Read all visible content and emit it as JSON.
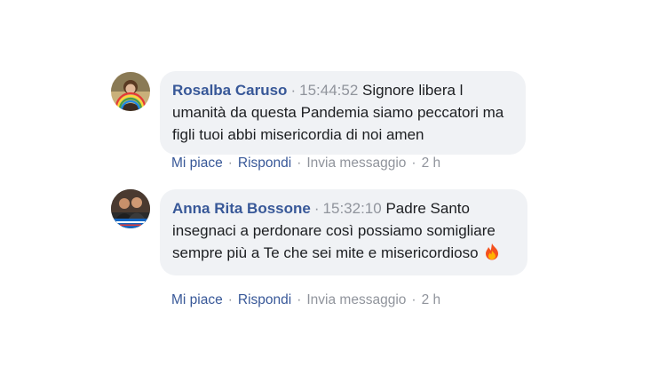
{
  "comments": [
    {
      "author": "Rosalba Caruso",
      "separator": "·",
      "timestamp": "15:44:52",
      "text": "Signore libera l umanità da questa Pandemia siamo peccatori ma figli tuoi abbi misericordia di noi amen",
      "actions": {
        "like": "Mi piace",
        "reply": "Rispondi",
        "message": "Invia messaggio",
        "age": "2 h",
        "dot": "·"
      }
    },
    {
      "author": "Anna Rita Bossone",
      "separator": "·",
      "timestamp": "15:32:10",
      "text": "Padre Santo insegnaci a perdonare così possiamo somigliare sempre più a Te che sei mite e misericordioso",
      "emoji": "fire-icon",
      "actions": {
        "like": "Mi piace",
        "reply": "Rispondi",
        "message": "Invia messaggio",
        "age": "2 h",
        "dot": "·"
      }
    }
  ],
  "colors": {
    "link": "#385898",
    "meta": "#90949c",
    "bubble": "#f0f2f5",
    "text": "#1c1e21"
  }
}
